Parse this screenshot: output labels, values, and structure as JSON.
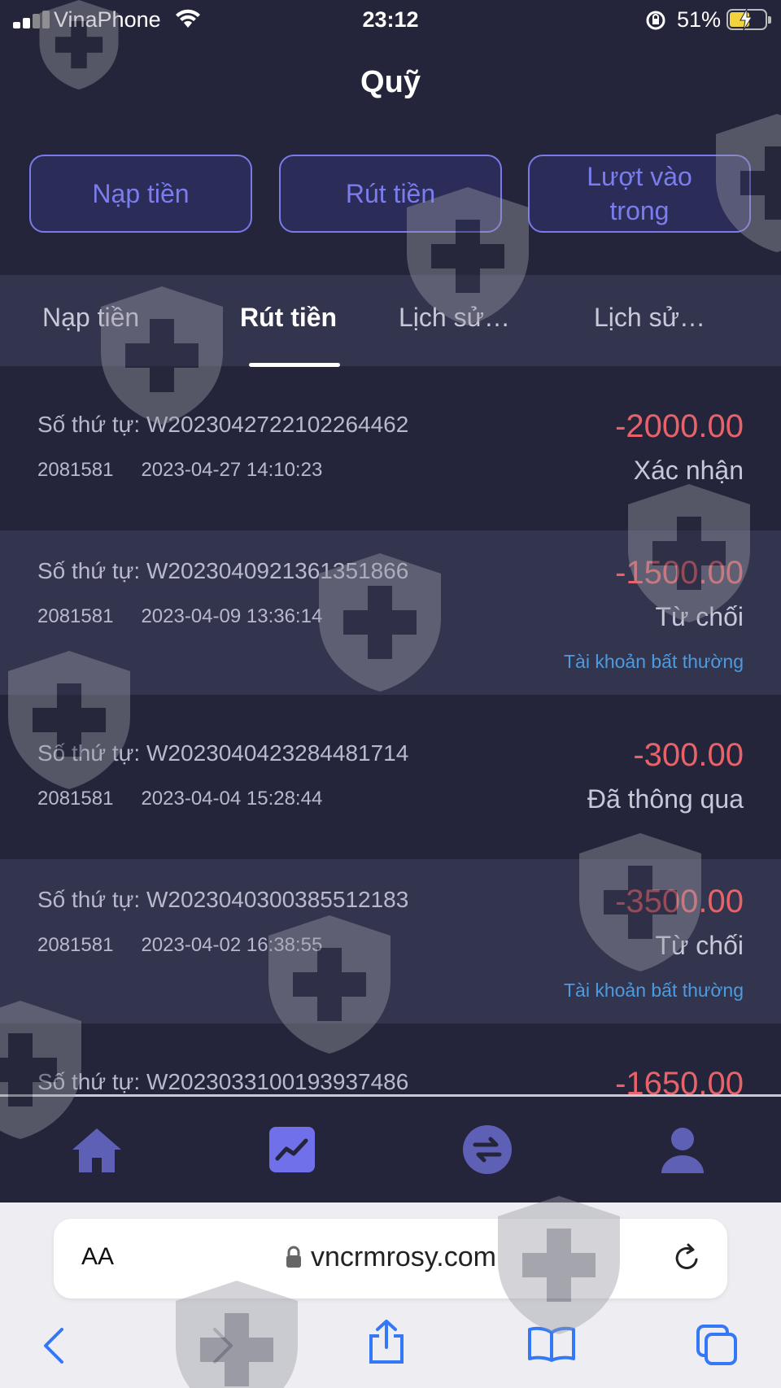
{
  "status_bar": {
    "carrier": "VinaPhone",
    "time": "23:12",
    "battery": "51%"
  },
  "header": {
    "title": "Quỹ"
  },
  "actions": [
    {
      "label": "Nạp tiền"
    },
    {
      "label": "Rút tiền"
    },
    {
      "label": "Lượt vào trong"
    }
  ],
  "tabs": [
    {
      "label": "Nạp tiền",
      "active": false
    },
    {
      "label": "Rút tiền",
      "active": true
    },
    {
      "label": "Lịch sử…",
      "active": false
    },
    {
      "label": "Lịch sử…",
      "active": false
    }
  ],
  "records": [
    {
      "order_label": "Số thứ tự:",
      "order_no": "W2023042722102264462",
      "user_id": "2081581",
      "datetime": "2023-04-27 14:10:23",
      "amount": "-2000.00",
      "status": "Xác nhận",
      "reason": ""
    },
    {
      "order_label": "Số thứ tự:",
      "order_no": "W2023040921361351866",
      "user_id": "2081581",
      "datetime": "2023-04-09 13:36:14",
      "amount": "-1500.00",
      "status": "Từ chối",
      "reason": "Tài khoản bất thường"
    },
    {
      "order_label": "Số thứ tự:",
      "order_no": "W2023040423284481714",
      "user_id": "2081581",
      "datetime": "2023-04-04 15:28:44",
      "amount": "-300.00",
      "status": "Đã thông qua",
      "reason": ""
    },
    {
      "order_label": "Số thứ tự:",
      "order_no": "W2023040300385512183",
      "user_id": "2081581",
      "datetime": "2023-04-02 16:38:55",
      "amount": "-3500.00",
      "status": "Từ chối",
      "reason": "Tài khoản bất thường"
    },
    {
      "order_label": "Số thứ tự:",
      "order_no": "W2023033100193937486",
      "user_id": "",
      "datetime": "",
      "amount": "-1650.00",
      "status": "",
      "reason": ""
    }
  ],
  "bottom_nav": [
    {
      "icon": "home-icon"
    },
    {
      "icon": "chart-icon"
    },
    {
      "icon": "exchange-icon"
    },
    {
      "icon": "user-icon"
    }
  ],
  "browser": {
    "text_size_label": "AA",
    "url": "vncrmrosy.com"
  },
  "colors": {
    "background": "#24253a",
    "alt_row": "#33354e",
    "accent": "#7a7be8",
    "amount": "#e8626a",
    "reason": "#4c9be0"
  }
}
